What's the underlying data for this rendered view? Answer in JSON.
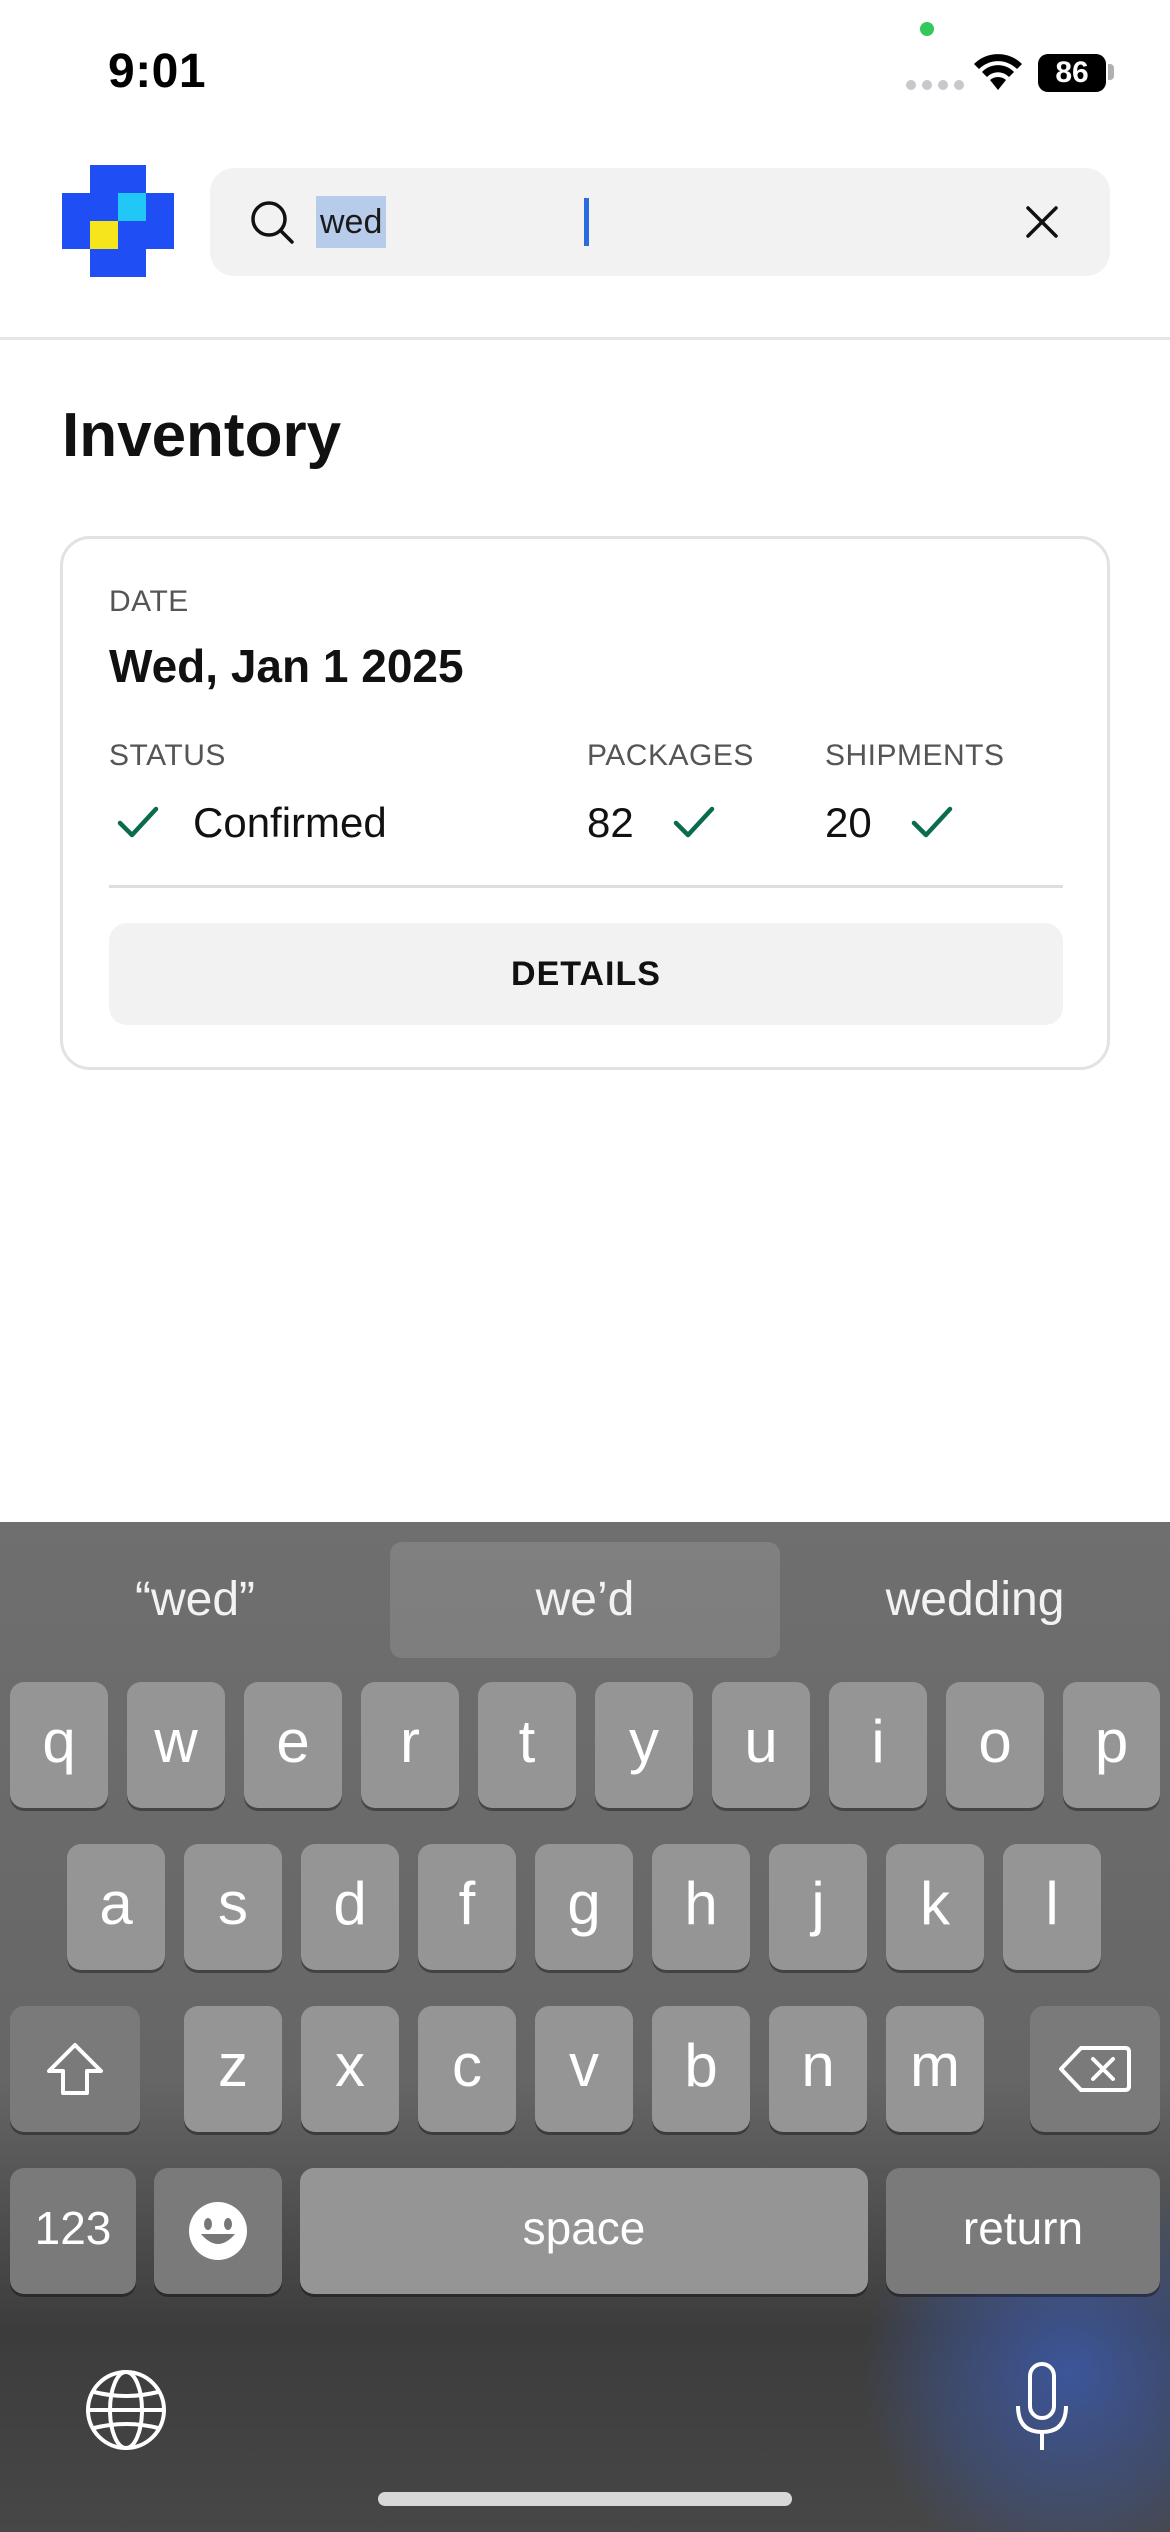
{
  "status_bar": {
    "time": "9:01",
    "battery": "86"
  },
  "search": {
    "value": "wed"
  },
  "page": {
    "title": "Inventory"
  },
  "card": {
    "date_label": "DATE",
    "date_value": "Wed, Jan 1 2025",
    "status_label": "STATUS",
    "status_value": "Confirmed",
    "packages_label": "PACKAGES",
    "packages_value": "82",
    "shipments_label": "SHIPMENTS",
    "shipments_value": "20",
    "details_label": "DETAILS"
  },
  "keyboard": {
    "suggestions": [
      "“wed”",
      "we’d",
      "wedding"
    ],
    "row1": [
      "q",
      "w",
      "e",
      "r",
      "t",
      "y",
      "u",
      "i",
      "o",
      "p"
    ],
    "row2": [
      "a",
      "s",
      "d",
      "f",
      "g",
      "h",
      "j",
      "k",
      "l"
    ],
    "row3": [
      "z",
      "x",
      "c",
      "v",
      "b",
      "n",
      "m"
    ],
    "numbers_label": "123",
    "space_label": "space",
    "return_label": "return"
  },
  "colors": {
    "accent_check": "#0b6b4f",
    "logo_blue": "#1f4ef5",
    "logo_cyan": "#21c8f5",
    "logo_yellow": "#f6e51a"
  }
}
